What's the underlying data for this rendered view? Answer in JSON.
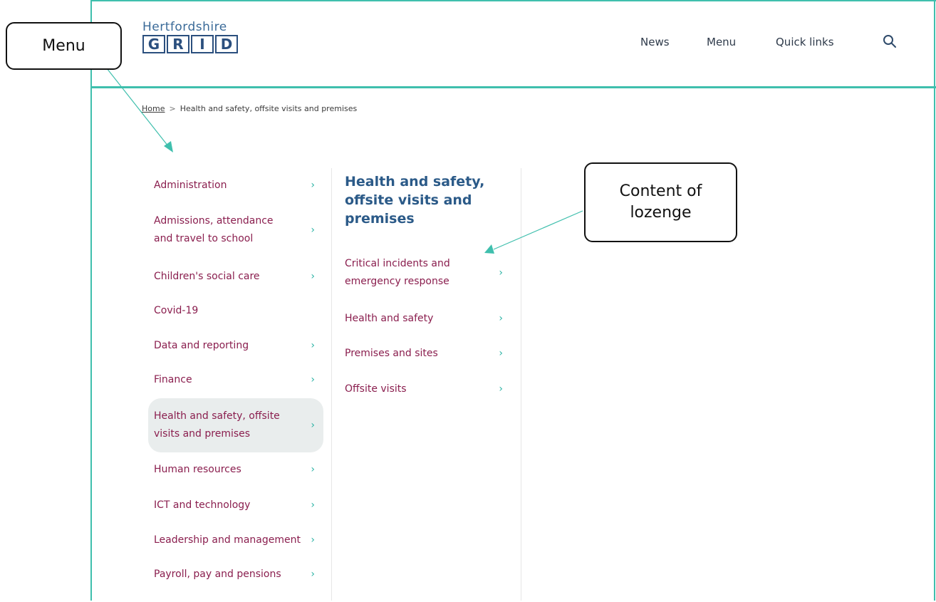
{
  "header": {
    "logo_top": "Hertfordshire",
    "logo_letters": [
      "G",
      "R",
      "I",
      "D"
    ],
    "nav": {
      "news": "News",
      "menu": "Menu",
      "quick_links": "Quick links"
    },
    "search_icon": "search-icon"
  },
  "breadcrumb": {
    "home": "Home",
    "separator": ">",
    "current": "Health and safety, offsite visits and premises"
  },
  "menu": {
    "items": [
      {
        "label": "Administration",
        "chevron": "›"
      },
      {
        "label": "Admissions, attendance and travel to school",
        "chevron": "›"
      },
      {
        "label": "Children's social care",
        "chevron": "›"
      },
      {
        "label": "Covid-19",
        "chevron": ""
      },
      {
        "label": "Data and reporting",
        "chevron": "›"
      },
      {
        "label": "Finance",
        "chevron": "›"
      },
      {
        "label": "Health and safety, offsite visits and premises",
        "chevron": "›",
        "active": true
      },
      {
        "label": "Human resources",
        "chevron": "›"
      },
      {
        "label": "ICT and technology",
        "chevron": "›"
      },
      {
        "label": "Leadership and management",
        "chevron": "›"
      },
      {
        "label": "Payroll, pay and pensions",
        "chevron": "›"
      }
    ]
  },
  "content": {
    "title": "Health and safety, offsite visits and premises",
    "items": [
      {
        "label": "Critical incidents and emergency response",
        "chevron": "›"
      },
      {
        "label": "Health and safety",
        "chevron": "›"
      },
      {
        "label": "Premises and sites",
        "chevron": "›"
      },
      {
        "label": "Offsite visits",
        "chevron": "›"
      }
    ]
  },
  "annotations": {
    "menu_label": "Menu",
    "content_label": "Content of lozenge"
  },
  "colors": {
    "accent": "#3fbfad",
    "link": "#8a1e4e",
    "title": "#2b5a88",
    "logo": "#2b4f7e"
  }
}
